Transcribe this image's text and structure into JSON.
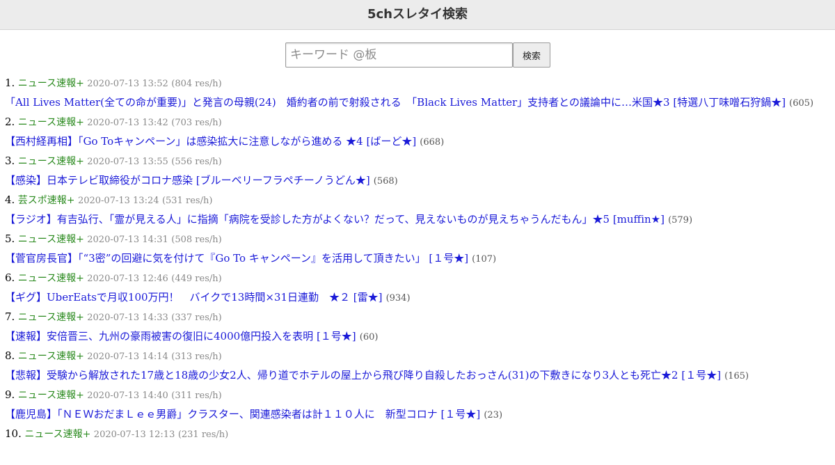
{
  "header": {
    "title": "5chスレタイ検索"
  },
  "search": {
    "placeholder": "キーワード @板",
    "button_label": "検索"
  },
  "results": [
    {
      "num": "1.",
      "board": "ニュース速報+",
      "datetime": "2020-07-13 13:52",
      "rate": "(804 res/h)",
      "title": "「All Lives Matter(全ての命が重要)」と発言の母親(24)　婚約者の前で射殺される　「Black Lives Matter」支持者との議論中に…米国★3 [特選八丁味噌石狩鍋★]",
      "count": "(605)"
    },
    {
      "num": "2.",
      "board": "ニュース速報+",
      "datetime": "2020-07-13 13:42",
      "rate": "(703 res/h)",
      "title": "【西村経再相】「Go Toキャンペーン」は感染拡大に注意しながら進める ★4 [ばーど★]",
      "count": "(668)"
    },
    {
      "num": "3.",
      "board": "ニュース速報+",
      "datetime": "2020-07-13 13:55",
      "rate": "(556 res/h)",
      "title": "【感染】日本テレビ取締役がコロナ感染 [ブルーベリーフラペチーノうどん★]",
      "count": "(568)"
    },
    {
      "num": "4.",
      "board": "芸スポ速報+",
      "datetime": "2020-07-13 13:24",
      "rate": "(531 res/h)",
      "title": "【ラジオ】有吉弘行、「霊が見える人」に指摘「病院を受診した方がよくない？だって、見えないものが見えちゃうんだもん」★5 [muffin★]",
      "count": "(579)"
    },
    {
      "num": "5.",
      "board": "ニュース速報+",
      "datetime": "2020-07-13 14:31",
      "rate": "(508 res/h)",
      "title": "【菅官房長官】「“3密”の回避に気を付けて『Go To キャンペーン』を活用して頂きたい」 [１号★]",
      "count": "(107)"
    },
    {
      "num": "6.",
      "board": "ニュース速報+",
      "datetime": "2020-07-13 12:46",
      "rate": "(449 res/h)",
      "title": "【ギグ】UberEatsで月収100万円！　バイクで13時間×31日連勤　★２ [雷★]",
      "count": "(934)"
    },
    {
      "num": "7.",
      "board": "ニュース速報+",
      "datetime": "2020-07-13 14:33",
      "rate": "(337 res/h)",
      "title": "【速報】安倍晋三、九州の豪雨被害の復旧に4000億円投入を表明 [１号★]",
      "count": "(60)"
    },
    {
      "num": "8.",
      "board": "ニュース速報+",
      "datetime": "2020-07-13 14:14",
      "rate": "(313 res/h)",
      "title": "【悲報】受験から解放された17歳と18歳の少女2人、帰り道でホテルの屋上から飛び降り自殺したおっさん(31)の下敷きになり3人とも死亡★2 [１号★]",
      "count": "(165)"
    },
    {
      "num": "9.",
      "board": "ニュース速報+",
      "datetime": "2020-07-13 14:40",
      "rate": "(311 res/h)",
      "title": "【鹿児島】「ＮＥＷおだまＬｅｅ男爵」クラスター、関連感染者は計１１０人に　新型コロナ [１号★]",
      "count": "(23)"
    },
    {
      "num": "10.",
      "board": "ニュース速報+",
      "datetime": "2020-07-13 12:13",
      "rate": "(231 res/h)",
      "title": "",
      "count": ""
    }
  ]
}
